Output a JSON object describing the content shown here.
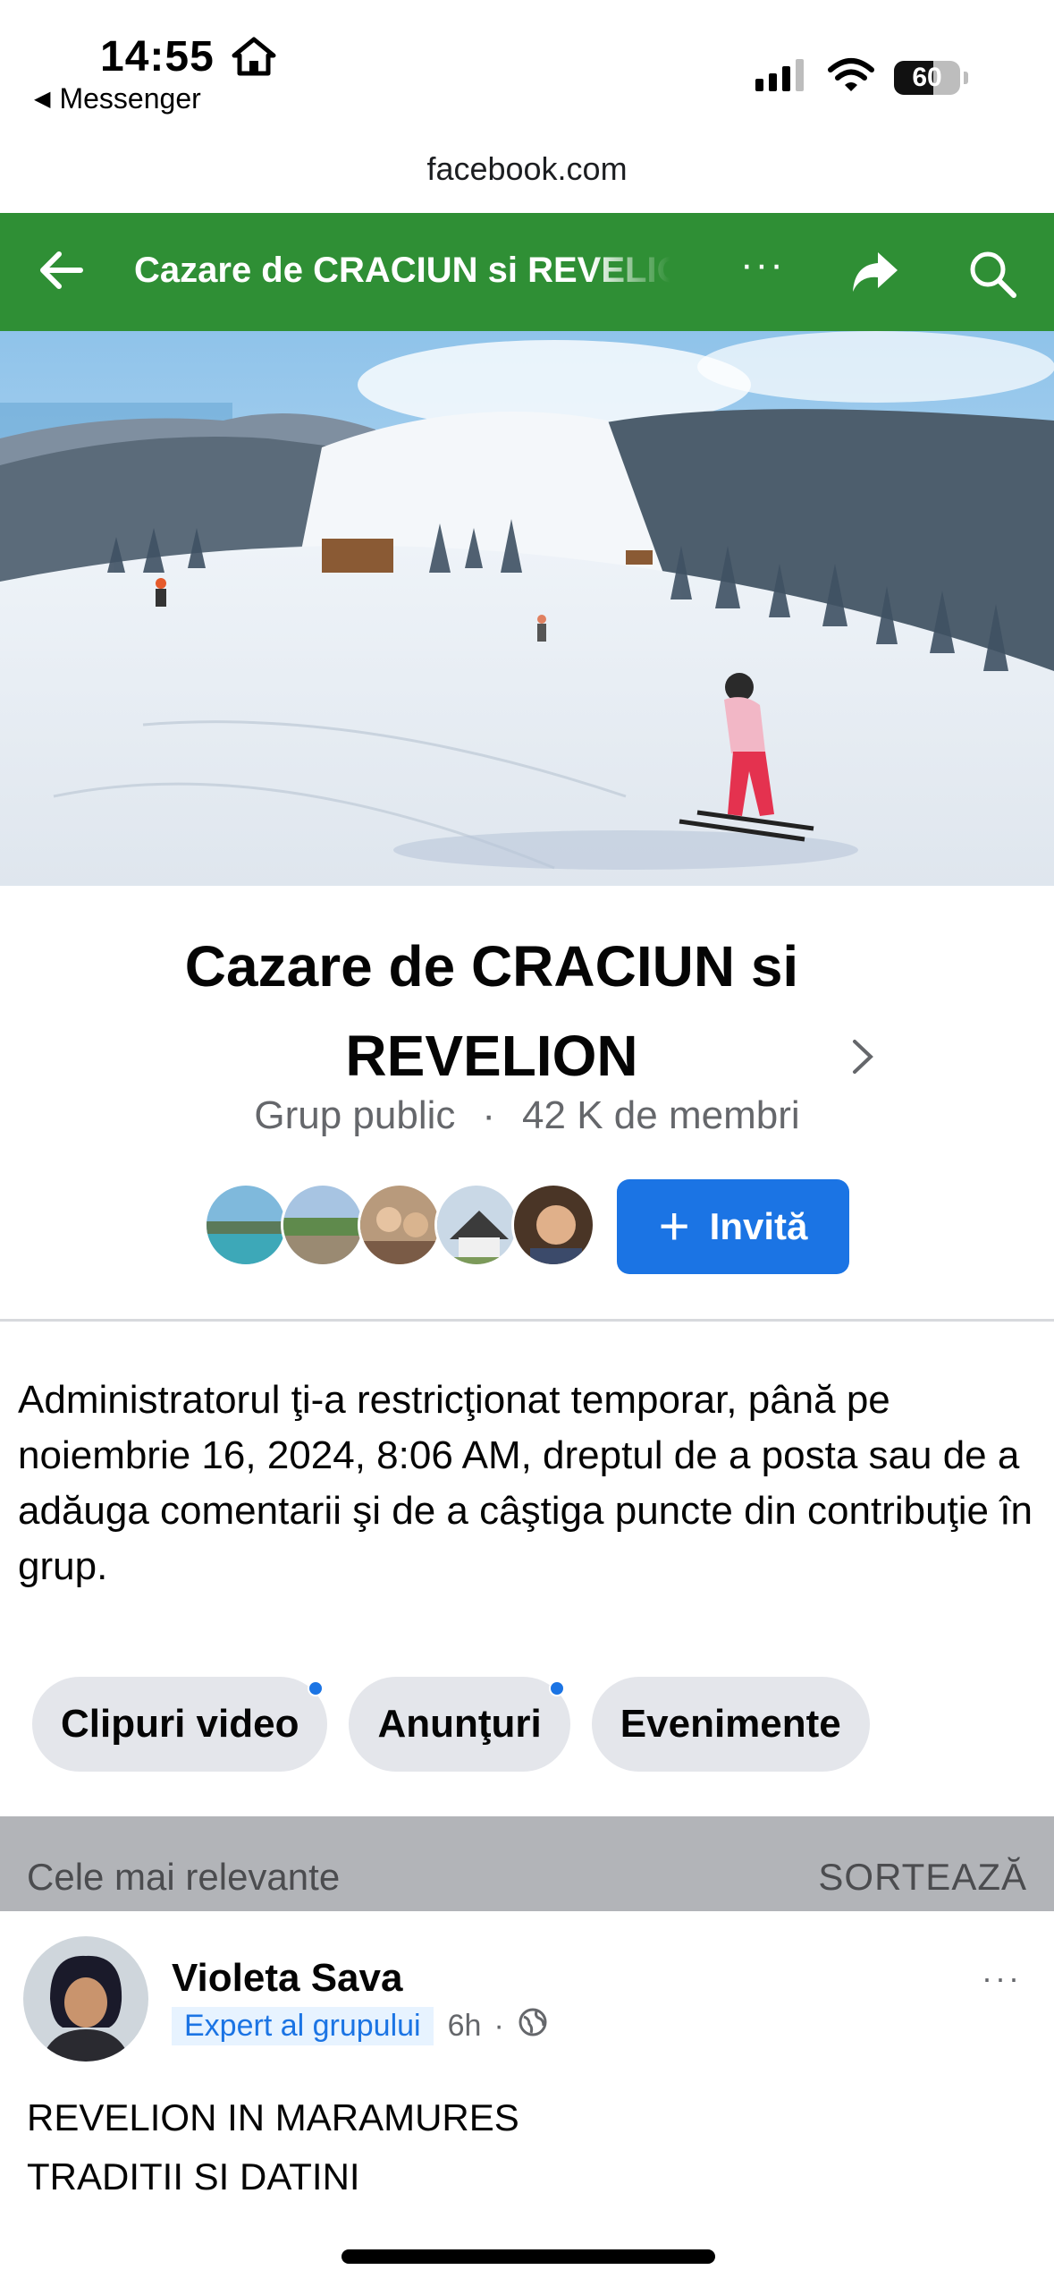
{
  "status_bar": {
    "time": "14:55",
    "back_app": "Messenger",
    "battery": "60",
    "battery_level": 0.6
  },
  "browser": {
    "url": "facebook.com"
  },
  "header": {
    "title": "Cazare de CRACIUN si REVELION",
    "more_label": "···",
    "accent": "#2f8f35"
  },
  "group": {
    "name": "Cazare de CRACIUN si REVELION",
    "privacy": "Grup public",
    "separator": "·",
    "members": "42 K de membri",
    "invite_label": "Invită"
  },
  "notice": "Administratorul ţi-a restricţionat temporar, până pe noiembrie 16, 2024, 8:06 AM, dreptul de a posta sau de a adăuga comentarii şi de a câştiga puncte din contribuţie în grup.",
  "chips": [
    {
      "label": "Clipuri video",
      "has_badge": true
    },
    {
      "label": "Anunţuri",
      "has_badge": true
    },
    {
      "label": "Evenimente",
      "has_badge": false
    }
  ],
  "sort": {
    "label": "Cele mai relevante",
    "action": "SORTEAZĂ"
  },
  "post": {
    "author": "Violeta Sava",
    "role": "Expert al grupului",
    "time": "6h",
    "dot": "·",
    "more": "···",
    "lines": [
      "REVELION IN MARAMURES",
      "TRADITII SI DATINI"
    ]
  },
  "icons": {
    "back": "arrow-left-icon",
    "share": "share-arrow-icon",
    "search": "search-icon",
    "globe": "globe-icon",
    "home": "home-icon"
  }
}
